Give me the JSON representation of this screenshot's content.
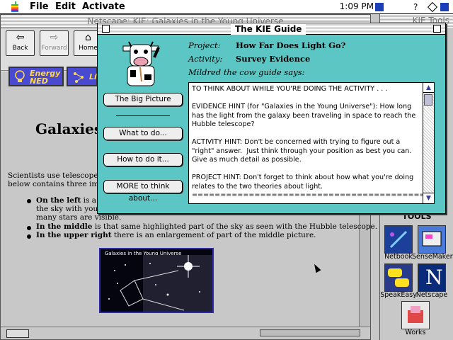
{
  "menubar": {
    "items": [
      "File",
      "Edit",
      "Activate"
    ],
    "clock": "1:09 PM"
  },
  "browser": {
    "title": "Netscape: KIE: Galaxies in the Young Universe",
    "nav": [
      {
        "label": "Back",
        "glyph": "⇦"
      },
      {
        "label": "Forward",
        "glyph": "⇨"
      },
      {
        "label": "Home",
        "glyph": "⌂"
      }
    ],
    "ned_button": {
      "line1": "Energy",
      "line2": "NED"
    },
    "link_button": "Li",
    "heading": "Galaxies",
    "intro1": "Scientists use telescopes to",
    "intro2": "below contains three image",
    "bullet1_bold": "On the left",
    "bullet1_rest": "is a p",
    "bullet1_line2": "the sky with your",
    "bullet1_line3": "many stars are visible.",
    "bullet2_bold": "In the middle",
    "bullet2_rest": "is that same highlighted part of the sky as seen with the Hubble telescope.",
    "bullet3_bold": "In the upper right",
    "bullet3_rest": "there is an enlargement of part of the middle picture.",
    "image_caption": "Galaxies in the Young Universe"
  },
  "tools": {
    "title": "KIE Tools",
    "heading": "TOOLS",
    "items": [
      {
        "label": "Netbook",
        "color": "#2e6fd1"
      },
      {
        "label": "SenseMaker",
        "color": "#3a7ad8"
      },
      {
        "label": "SpeakEasy",
        "color": "#e0c020"
      },
      {
        "label": "Netscape",
        "color": "#0a2a7a"
      },
      {
        "label": "Works",
        "color": "#e04848"
      }
    ]
  },
  "kie": {
    "title": "The KIE Guide",
    "project_label": "Project:",
    "project_value": "How Far Does Light Go?",
    "activity_label": "Activity:",
    "activity_value": "Survey Evidence",
    "says": "Mildred the cow guide says:",
    "buttons": [
      "The Big Picture",
      "What to do...",
      "How to do it...",
      "MORE to think about..."
    ],
    "hint_text": "TO THINK ABOUT WHILE YOU'RE DOING THE ACTIVITY . . .\n\nEVIDENCE HINT (for \"Galaxies in the Young Universe\"): How long has the light from the galaxy been traveling in space to reach the Hubble telescope?\n\nACTIVITY HINT: Don't be concerned with trying to figure out a \"right\" answer.  Just think through your position as best you can. Give as much detail as possible.\n\nPROJECT HINT: Don't forget to think about how what you're doing relates to the two theories about light.\n====================================================="
  },
  "colors": {
    "guide_bg": "#5cc6c4",
    "ned_bg": "#4a4ad0",
    "ned_text": "#ffd84a"
  }
}
